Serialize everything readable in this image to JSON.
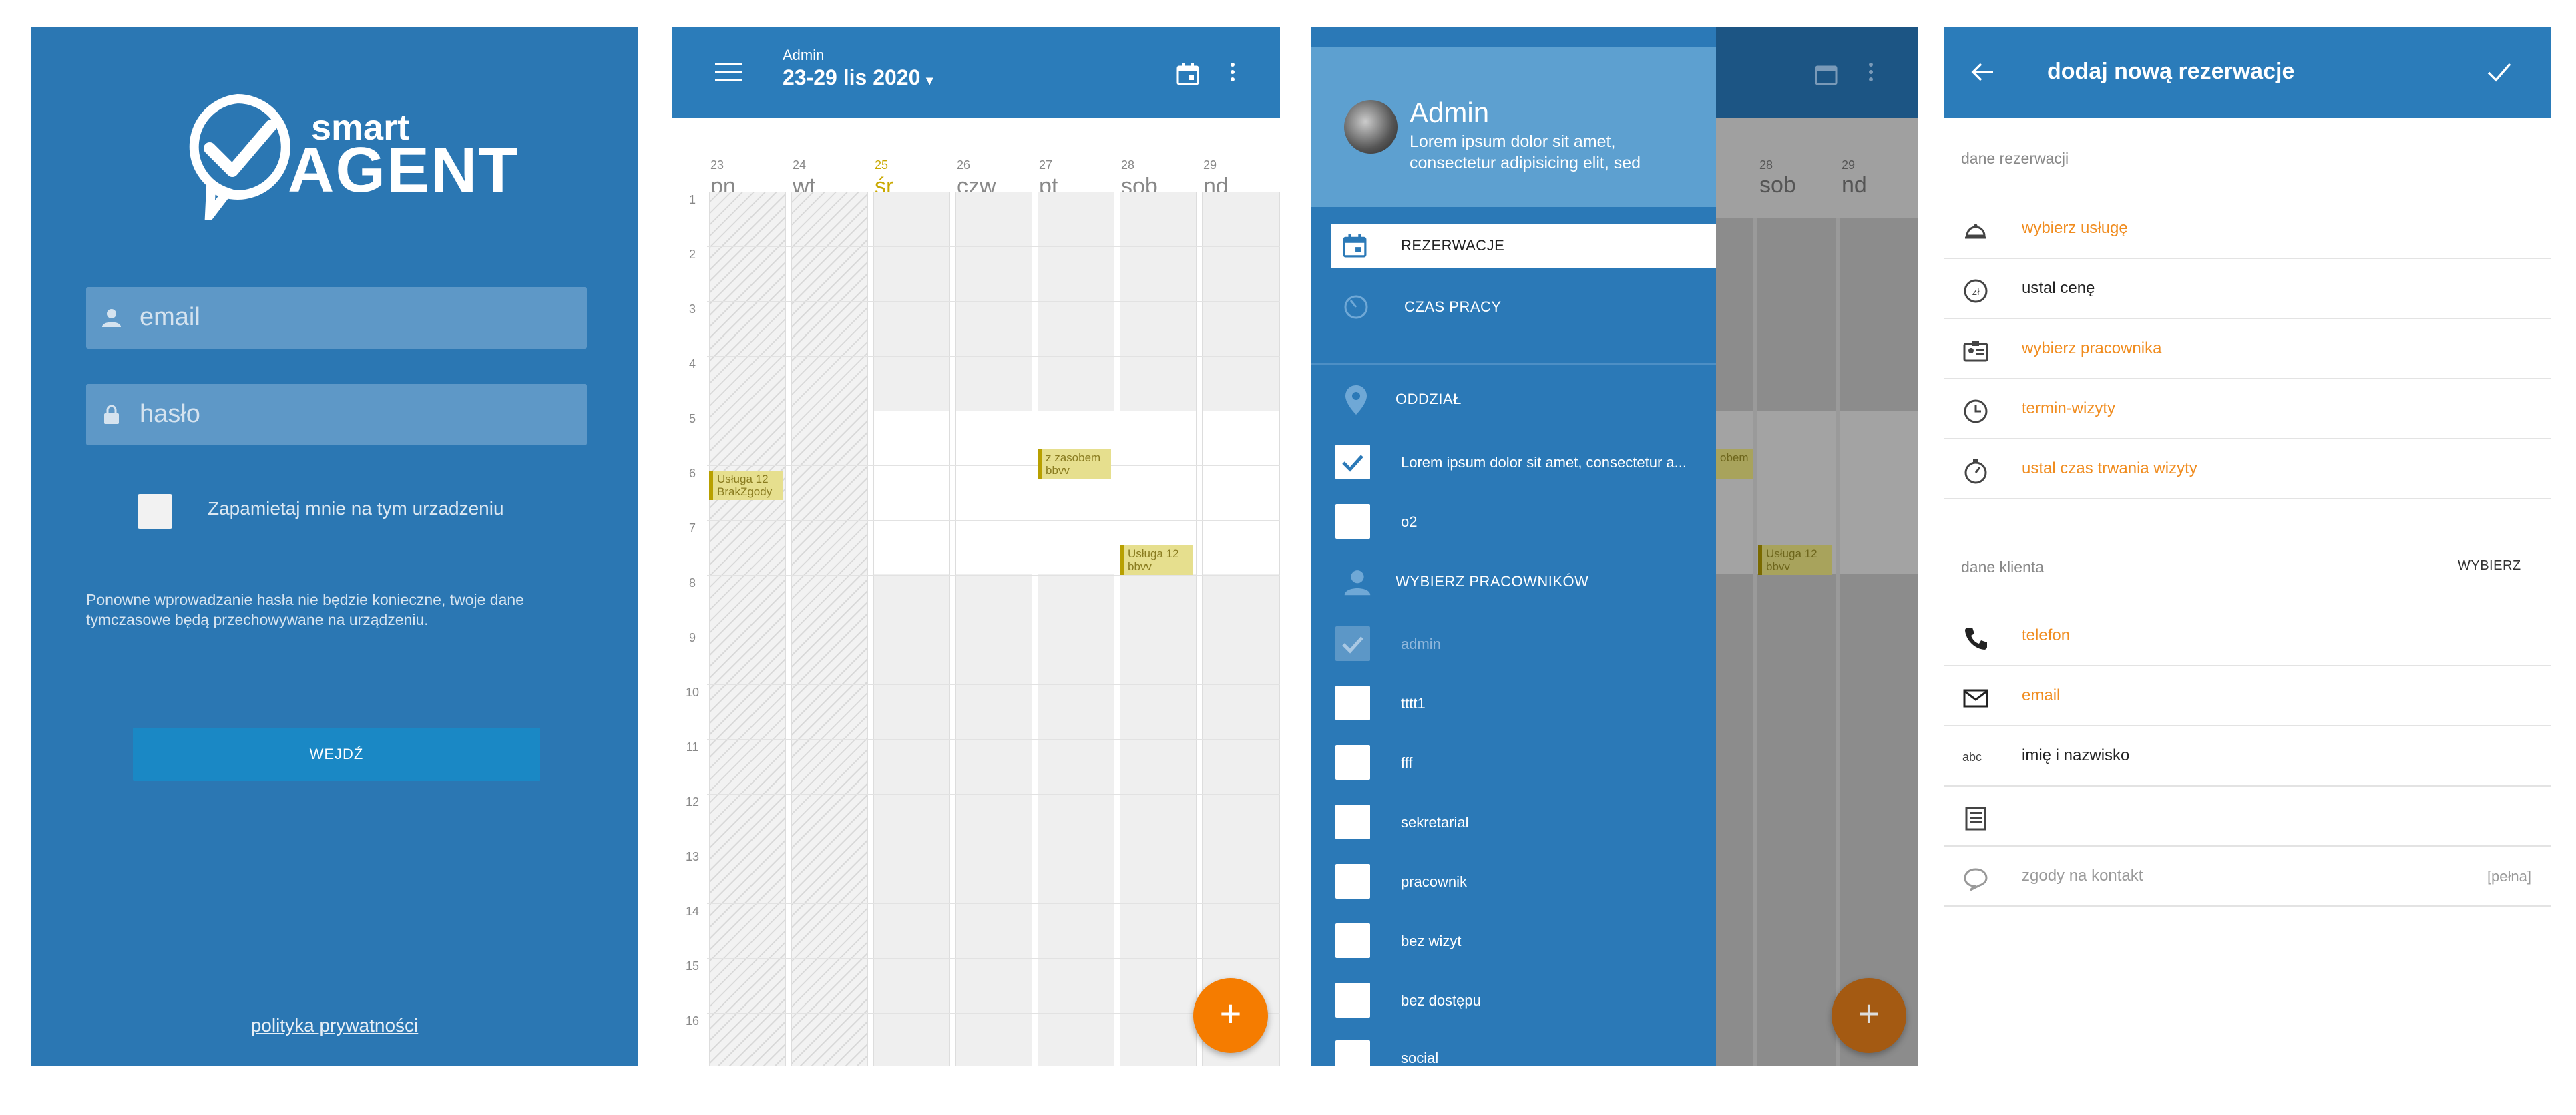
{
  "login": {
    "logo_small": "smart",
    "logo_big": "AGENT",
    "email_placeholder": "email",
    "password_placeholder": "hasło",
    "remember_label": "Zapamietaj mnie na tym urzadzeniu",
    "info_text": "Ponowne wprowadzanie hasła nie będzie konieczne, twoje dane tymczasowe będą przechowywane na urządzeniu.",
    "enter_button": "WEJDŹ",
    "privacy_link": "polityka prywatności"
  },
  "calendar": {
    "user": "Admin",
    "range": "23-29 lis 2020",
    "days": [
      {
        "num": "23",
        "name": "pn"
      },
      {
        "num": "24",
        "name": "wt"
      },
      {
        "num": "25",
        "name": "śr"
      },
      {
        "num": "26",
        "name": "czw"
      },
      {
        "num": "27",
        "name": "pt"
      },
      {
        "num": "28",
        "name": "sob"
      },
      {
        "num": "29",
        "name": "nd"
      }
    ],
    "hours": [
      "1",
      "2",
      "3",
      "4",
      "5",
      "6",
      "7",
      "8",
      "9",
      "10",
      "11",
      "12",
      "13",
      "14",
      "15",
      "16"
    ],
    "events": [
      {
        "line1": "Usługa 12",
        "line2": "BrakZgody"
      },
      {
        "line1": "z zasobem",
        "line2": "bbvv"
      },
      {
        "line1": "Usługa 12",
        "line2": "bbvv"
      }
    ],
    "fab": "+",
    "today_color": "#c9a800"
  },
  "drawer": {
    "name": "Admin",
    "description": "Lorem ipsum dolor sit amet, consectetur adipisicing elit, sed",
    "menu": {
      "reservations": "REZERWACJE",
      "work_time": "CZAS PRACY",
      "branch": "ODDZIAŁ",
      "branch_option_1": "Lorem ipsum dolor sit amet, consectetur a...",
      "branch_option_2": "o2",
      "choose_employees": "WYBIERZ PRACOWNIKÓW"
    },
    "employees": [
      "admin",
      "tttt1",
      "fff",
      "sekretarial",
      "pracownik",
      "bez wizyt",
      "bez dostępu",
      "social"
    ],
    "bg_days": [
      {
        "num": "28",
        "name": "sob"
      },
      {
        "num": "29",
        "name": "nd"
      }
    ],
    "bg_event_1": "obem",
    "bg_event_2_line1": "Usługa 12",
    "bg_event_2_line2": "bbvv",
    "fab": "+"
  },
  "form": {
    "title": "dodaj nową rezerwacje",
    "section_reservation": "dane rezerwacji",
    "choose_service": "wybierz usługę",
    "set_price": "ustal cenę",
    "choose_employee": "wybierz pracownika",
    "visit_date": "termin-wizyty",
    "set_duration": "ustal czas trwania wizyty",
    "section_client": "dane klienta",
    "choose": "WYBIERZ",
    "phone": "telefon",
    "email": "email",
    "name": "imię i nazwisko",
    "notes": "",
    "consents": "zgody na kontakt",
    "consents_value": "[pełna]",
    "name_icon": "abc"
  },
  "colors": {
    "primary": "#2b7cba",
    "accent": "#f57c00",
    "orange_text": "#f08c1f"
  }
}
